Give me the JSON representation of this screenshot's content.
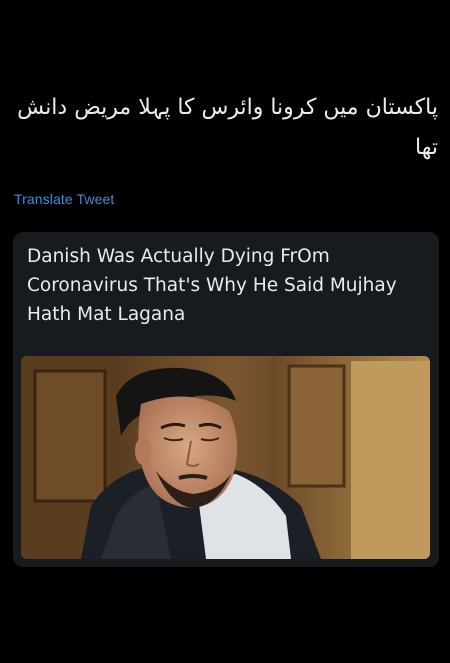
{
  "tweet": {
    "text": "پاکستان میں کرونا وائرس کا پہلا مریض دانش تھا",
    "translate_label": "Translate Tweet"
  },
  "card": {
    "headline": "Danish Was Actually Dying FrOm Coronavirus That's Why He Said Mujhay Hath Mat Lagana"
  },
  "colors": {
    "background": "#000000",
    "card_background": "#171b20",
    "link": "#3b8fd6",
    "text": "#ececec"
  }
}
